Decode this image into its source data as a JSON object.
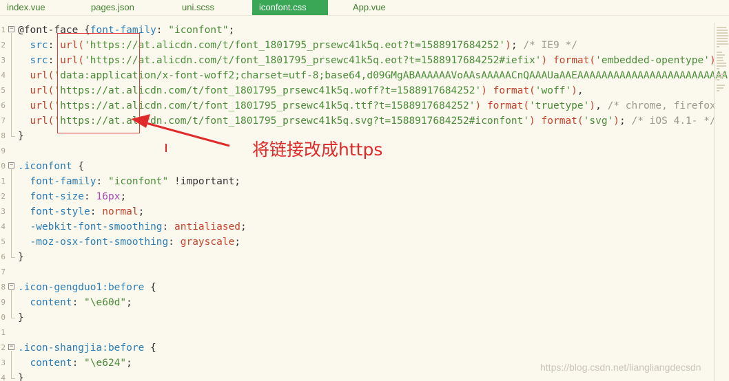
{
  "tabs": [
    {
      "label": "index.vue",
      "active": false
    },
    {
      "label": "pages.json",
      "active": false
    },
    {
      "label": "uni.scss",
      "active": false
    },
    {
      "label": "iconfont.css",
      "active": true
    },
    {
      "label": "App.vue",
      "active": false
    }
  ],
  "lines": [
    {
      "n": "1",
      "fold": "open",
      "tokens": [
        [
          "plain",
          "@font-face {"
        ],
        [
          "prop",
          "font-family"
        ],
        [
          "plain",
          ": "
        ],
        [
          "str",
          "\"iconfont\""
        ],
        [
          "plain",
          ";"
        ]
      ]
    },
    {
      "n": "2",
      "tokens": [
        [
          "plain",
          "  "
        ],
        [
          "prop",
          "src"
        ],
        [
          "plain",
          ": "
        ],
        [
          "fn",
          "url("
        ],
        [
          "str",
          "'https://at.alicdn.com/t/font_1801795_prsewc41k5q.eot?t=1588917684252'"
        ],
        [
          "fn",
          ")"
        ],
        [
          "plain",
          "; "
        ],
        [
          "cmt",
          "/* IE9 */"
        ]
      ]
    },
    {
      "n": "3",
      "tokens": [
        [
          "plain",
          "  "
        ],
        [
          "prop",
          "src"
        ],
        [
          "plain",
          ": "
        ],
        [
          "fn",
          "url("
        ],
        [
          "str",
          "'https://at.alicdn.com/t/font_1801795_prsewc41k5q.eot?t=1588917684252#iefix'"
        ],
        [
          "fn",
          ")"
        ],
        [
          "plain",
          " "
        ],
        [
          "fn",
          "format("
        ],
        [
          "str",
          "'embedded-opentype'"
        ],
        [
          "fn",
          ")"
        ]
      ]
    },
    {
      "n": "4",
      "tokens": [
        [
          "plain",
          "  "
        ],
        [
          "fn",
          "url("
        ],
        [
          "str",
          "'data:application/x-font-woff2;charset=utf-8;base64,d09GMgABAAAAAAVoAAsAAAAACnQAAAUaAAEAAAAAAAAAAAAAAAAAAAAAAAAA"
        ]
      ]
    },
    {
      "n": "5",
      "tokens": [
        [
          "plain",
          "  "
        ],
        [
          "fn",
          "url("
        ],
        [
          "str",
          "'https://at.alicdn.com/t/font_1801795_prsewc41k5q.woff?t=1588917684252'"
        ],
        [
          "fn",
          ")"
        ],
        [
          "plain",
          " "
        ],
        [
          "fn",
          "format("
        ],
        [
          "str",
          "'woff'"
        ],
        [
          "fn",
          ")"
        ],
        [
          "plain",
          ","
        ]
      ]
    },
    {
      "n": "6",
      "tokens": [
        [
          "plain",
          "  "
        ],
        [
          "fn",
          "url("
        ],
        [
          "str",
          "'https://at.alicdn.com/t/font_1801795_prsewc41k5q.ttf?t=1588917684252'"
        ],
        [
          "fn",
          ")"
        ],
        [
          "plain",
          " "
        ],
        [
          "fn",
          "format("
        ],
        [
          "str",
          "'truetype'"
        ],
        [
          "fn",
          ")"
        ],
        [
          "plain",
          ", "
        ],
        [
          "cmt",
          "/* chrome, firefox"
        ]
      ]
    },
    {
      "n": "7",
      "tokens": [
        [
          "plain",
          "  "
        ],
        [
          "fn",
          "url("
        ],
        [
          "str",
          "'https://at.alicdn.com/t/font_1801795_prsewc41k5q.svg?t=1588917684252#iconfont'"
        ],
        [
          "fn",
          ")"
        ],
        [
          "plain",
          " "
        ],
        [
          "fn",
          "format("
        ],
        [
          "str",
          "'svg'"
        ],
        [
          "fn",
          ")"
        ],
        [
          "plain",
          "; "
        ],
        [
          "cmt",
          "/* iOS 4.1- */"
        ]
      ]
    },
    {
      "n": "8",
      "foldend": true,
      "tokens": [
        [
          "plain",
          "}"
        ]
      ]
    },
    {
      "n": "9",
      "tokens": []
    },
    {
      "n": "0",
      "fold": "open",
      "tokens": [
        [
          "sel",
          ".iconfont"
        ],
        [
          "plain",
          " {"
        ]
      ]
    },
    {
      "n": "1",
      "tokens": [
        [
          "plain",
          "  "
        ],
        [
          "prop",
          "font-family"
        ],
        [
          "plain",
          ": "
        ],
        [
          "str",
          "\"iconfont\""
        ],
        [
          "plain",
          " !important;"
        ]
      ]
    },
    {
      "n": "2",
      "tokens": [
        [
          "plain",
          "  "
        ],
        [
          "prop",
          "font-size"
        ],
        [
          "plain",
          ": "
        ],
        [
          "num",
          "16px"
        ],
        [
          "plain",
          ";"
        ]
      ]
    },
    {
      "n": "3",
      "tokens": [
        [
          "plain",
          "  "
        ],
        [
          "prop",
          "font-style"
        ],
        [
          "plain",
          ": "
        ],
        [
          "val",
          "normal"
        ],
        [
          "plain",
          ";"
        ]
      ]
    },
    {
      "n": "4",
      "tokens": [
        [
          "plain",
          "  "
        ],
        [
          "prop",
          "-webkit-font-smoothing"
        ],
        [
          "plain",
          ": "
        ],
        [
          "val",
          "antialiased"
        ],
        [
          "plain",
          ";"
        ]
      ]
    },
    {
      "n": "5",
      "tokens": [
        [
          "plain",
          "  "
        ],
        [
          "prop",
          "-moz-osx-font-smoothing"
        ],
        [
          "plain",
          ": "
        ],
        [
          "val",
          "grayscale"
        ],
        [
          "plain",
          ";"
        ]
      ]
    },
    {
      "n": "6",
      "foldend": true,
      "tokens": [
        [
          "plain",
          "}"
        ]
      ]
    },
    {
      "n": "7",
      "tokens": []
    },
    {
      "n": "8",
      "fold": "open",
      "tokens": [
        [
          "sel",
          ".icon-gengduo1:before"
        ],
        [
          "plain",
          " {"
        ]
      ]
    },
    {
      "n": "9",
      "tokens": [
        [
          "plain",
          "  "
        ],
        [
          "prop",
          "content"
        ],
        [
          "plain",
          ": "
        ],
        [
          "str",
          "\"\\e60d\""
        ],
        [
          "plain",
          ";"
        ]
      ]
    },
    {
      "n": "0",
      "foldend": true,
      "tokens": [
        [
          "plain",
          "}"
        ]
      ]
    },
    {
      "n": "1",
      "tokens": []
    },
    {
      "n": "2",
      "fold": "open",
      "tokens": [
        [
          "sel",
          ".icon-shangjia:before"
        ],
        [
          "plain",
          " {"
        ]
      ]
    },
    {
      "n": "3",
      "tokens": [
        [
          "plain",
          "  "
        ],
        [
          "prop",
          "content"
        ],
        [
          "plain",
          ": "
        ],
        [
          "str",
          "\"\\e624\""
        ],
        [
          "plain",
          ";"
        ]
      ]
    },
    {
      "n": "4",
      "foldend": true,
      "tokens": [
        [
          "plain",
          "}"
        ]
      ]
    }
  ],
  "annotation": {
    "text": "将链接改成https",
    "color": "#e02a2a"
  },
  "watermark": "https://blog.csdn.net/liangliangdecsdn",
  "colors": {
    "active_tab": "#3aa757",
    "background": "#fbf8ee"
  }
}
